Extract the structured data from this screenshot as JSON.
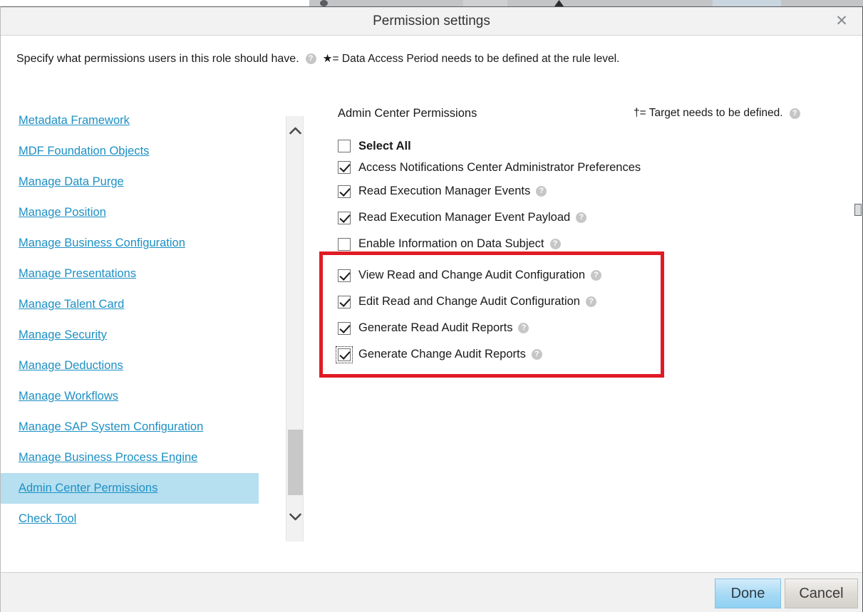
{
  "window": {
    "title": "Permission settings",
    "close_label": "✕"
  },
  "instruction": {
    "text": "Specify what permissions users in this role should have.",
    "help_icon": "?",
    "star_note": "★= Data Access Period needs to be defined at the rule level."
  },
  "right_panel": {
    "header": "Admin Center Permissions",
    "dagger_note": "†= Target needs to be defined.",
    "dagger_help_icon": "?"
  },
  "sidebar": {
    "items": [
      {
        "label": "Metadata Framework",
        "selected": false
      },
      {
        "label": "MDF Foundation Objects",
        "selected": false
      },
      {
        "label": "Manage Data Purge",
        "selected": false
      },
      {
        "label": "Manage Position",
        "selected": false
      },
      {
        "label": "Manage Business Configuration",
        "selected": false
      },
      {
        "label": "Manage Presentations",
        "selected": false
      },
      {
        "label": "Manage Talent Card",
        "selected": false
      },
      {
        "label": "Manage Security",
        "selected": false
      },
      {
        "label": "Manage Deductions",
        "selected": false
      },
      {
        "label": "Manage Workflows",
        "selected": false
      },
      {
        "label": "Manage SAP System Configuration",
        "selected": false
      },
      {
        "label": "Manage Business Process Engine",
        "selected": false
      },
      {
        "label": "Admin Center Permissions",
        "selected": true
      },
      {
        "label": "Check Tool",
        "selected": false
      }
    ]
  },
  "permissions": {
    "top_rows": [
      {
        "label": "Select All",
        "checked": false,
        "bold": true,
        "help": false
      },
      {
        "label": "Access Notifications Center Administrator Preferences",
        "checked": true,
        "bold": false,
        "help": false
      },
      {
        "label": "Read Execution Manager Events",
        "checked": true,
        "bold": false,
        "help": true
      },
      {
        "label": "Read Execution Manager Event Payload",
        "checked": true,
        "bold": false,
        "help": true
      },
      {
        "label": "Enable Information on Data Subject",
        "checked": false,
        "bold": false,
        "help": true
      }
    ],
    "highlighted_rows": [
      {
        "label": "View Read and Change Audit Configuration",
        "checked": true,
        "focused": false,
        "help": true
      },
      {
        "label": "Edit Read and Change Audit Configuration",
        "checked": true,
        "focused": false,
        "help": true
      },
      {
        "label": "Generate Read Audit Reports",
        "checked": true,
        "focused": false,
        "help": true
      },
      {
        "label": "Generate Change Audit Reports",
        "checked": true,
        "focused": true,
        "help": true
      }
    ],
    "help_icon": "?"
  },
  "footer": {
    "done_label": "Done",
    "cancel_label": "Cancel"
  },
  "colors": {
    "link": "#1d90c4",
    "selected_row": "#b6dff0",
    "highlight_border": "#e01b24",
    "titlebar_bg": "#f2f2f2",
    "footer_bg": "#f1f1f1",
    "done_button": "#a6d9f5"
  }
}
